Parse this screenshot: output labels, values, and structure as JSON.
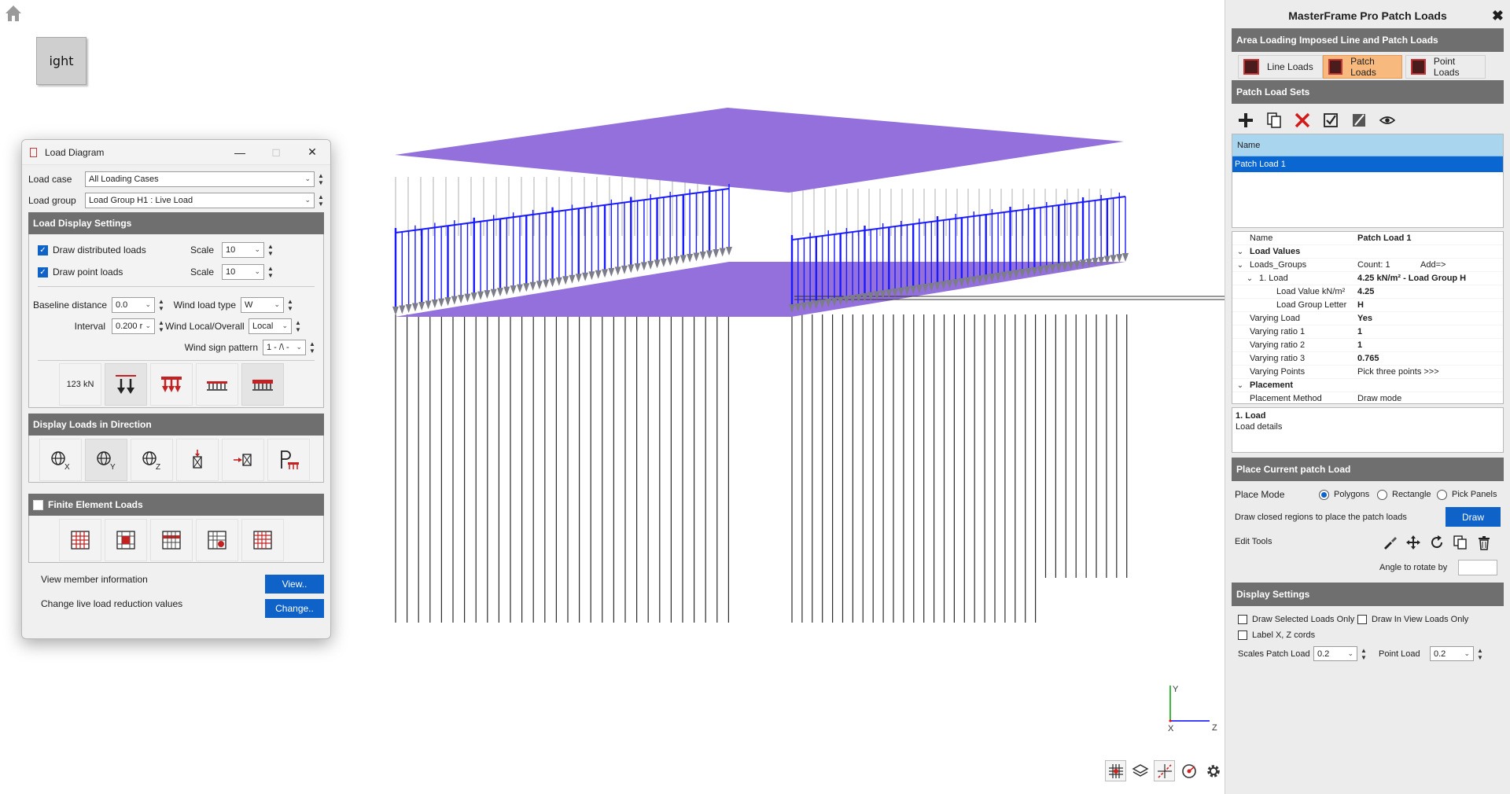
{
  "view_cube": {
    "label": "ight"
  },
  "axes": {
    "y": "Y",
    "x": "X",
    "z": "Z"
  },
  "load_diagram": {
    "title": "Load Diagram",
    "load_case_label": "Load case",
    "load_case_value": "All Loading Cases",
    "load_group_label": "Load group",
    "load_group_value": "Load Group H1 : Live Load",
    "display_settings_header": "Load Display Settings",
    "draw_distributed_label": "Draw distributed loads",
    "draw_point_label": "Draw point loads",
    "scale_label": "Scale",
    "scale_distributed_value": "10",
    "scale_point_value": "10",
    "baseline_label": "Baseline distance",
    "baseline_value": "0.0",
    "interval_label": "Interval",
    "interval_value": "0.200 r",
    "wind_type_label": "Wind load type",
    "wind_type_value": "W",
    "wind_local_label": "Wind Local/Overall",
    "wind_local_value": "Local",
    "wind_sign_label": "Wind sign pattern",
    "wind_sign_value": "1 - /\\ -",
    "kn_button_label": "123 kN",
    "direction_header": "Display Loads in Direction",
    "fe_header": "Finite Element Loads",
    "view_member_label": "View member information",
    "view_button": "View..",
    "live_load_label": "Change live load reduction values",
    "change_button": "Change.."
  },
  "side_panel": {
    "title": "MasterFrame Pro Patch Loads",
    "area_header": "Area Loading Imposed Line and Patch Loads",
    "tabs": [
      {
        "label": "Line Loads"
      },
      {
        "label": "Patch Loads"
      },
      {
        "label": "Point Loads"
      }
    ],
    "sets_header": "Patch Load Sets",
    "list_column_header": "Name",
    "list_rows": [
      "Patch Load 1"
    ],
    "properties": [
      {
        "k": "Name",
        "v": "Patch Load 1"
      },
      {
        "k": "Load Values",
        "v": ""
      },
      {
        "k": "Loads_Groups",
        "v": "Count: 1",
        "extra": "Add=>"
      },
      {
        "k": "1. Load",
        "v": "4.25 kN/m² - Load Group H"
      },
      {
        "k": "Load Value kN/m²",
        "v": "4.25"
      },
      {
        "k": "Load Group Letter",
        "v": "H"
      },
      {
        "k": "Varying Load",
        "v": "Yes"
      },
      {
        "k": "Varying ratio 1",
        "v": "1"
      },
      {
        "k": "Varying ratio 2",
        "v": "1"
      },
      {
        "k": "Varying ratio 3",
        "v": "0.765"
      },
      {
        "k": "Varying Points",
        "v": "Pick three points >>>"
      },
      {
        "k": "Placement",
        "v": ""
      },
      {
        "k": "Placement Method",
        "v": "Draw mode"
      }
    ],
    "desc_title": "1. Load",
    "desc_text": "Load details",
    "place_header": "Place Current patch Load",
    "place_mode_label": "Place Mode",
    "place_modes": [
      "Polygons",
      "Rectangle",
      "Pick Panels"
    ],
    "draw_hint": "Draw closed regions to place the patch loads",
    "draw_button": "Draw",
    "edit_tools_label": "Edit Tools",
    "angle_label": "Angle to rotate by",
    "display_header": "Display Settings",
    "draw_selected_label": "Draw Selected Loads Only",
    "draw_in_view_label": "Draw In View Loads Only",
    "label_xz_label": "Label X, Z cords",
    "scales_label": "Scales",
    "patch_load_label": "Patch Load",
    "patch_load_value": "0.2",
    "point_load_label": "Point Load",
    "point_load_value": "0.2"
  },
  "colors": {
    "slab": "#9370db",
    "load_arrows": "#1a1aff",
    "section_header": "#6f6f6f",
    "accent_blue": "#0f62c7",
    "active_tab": "#f7b97d"
  }
}
